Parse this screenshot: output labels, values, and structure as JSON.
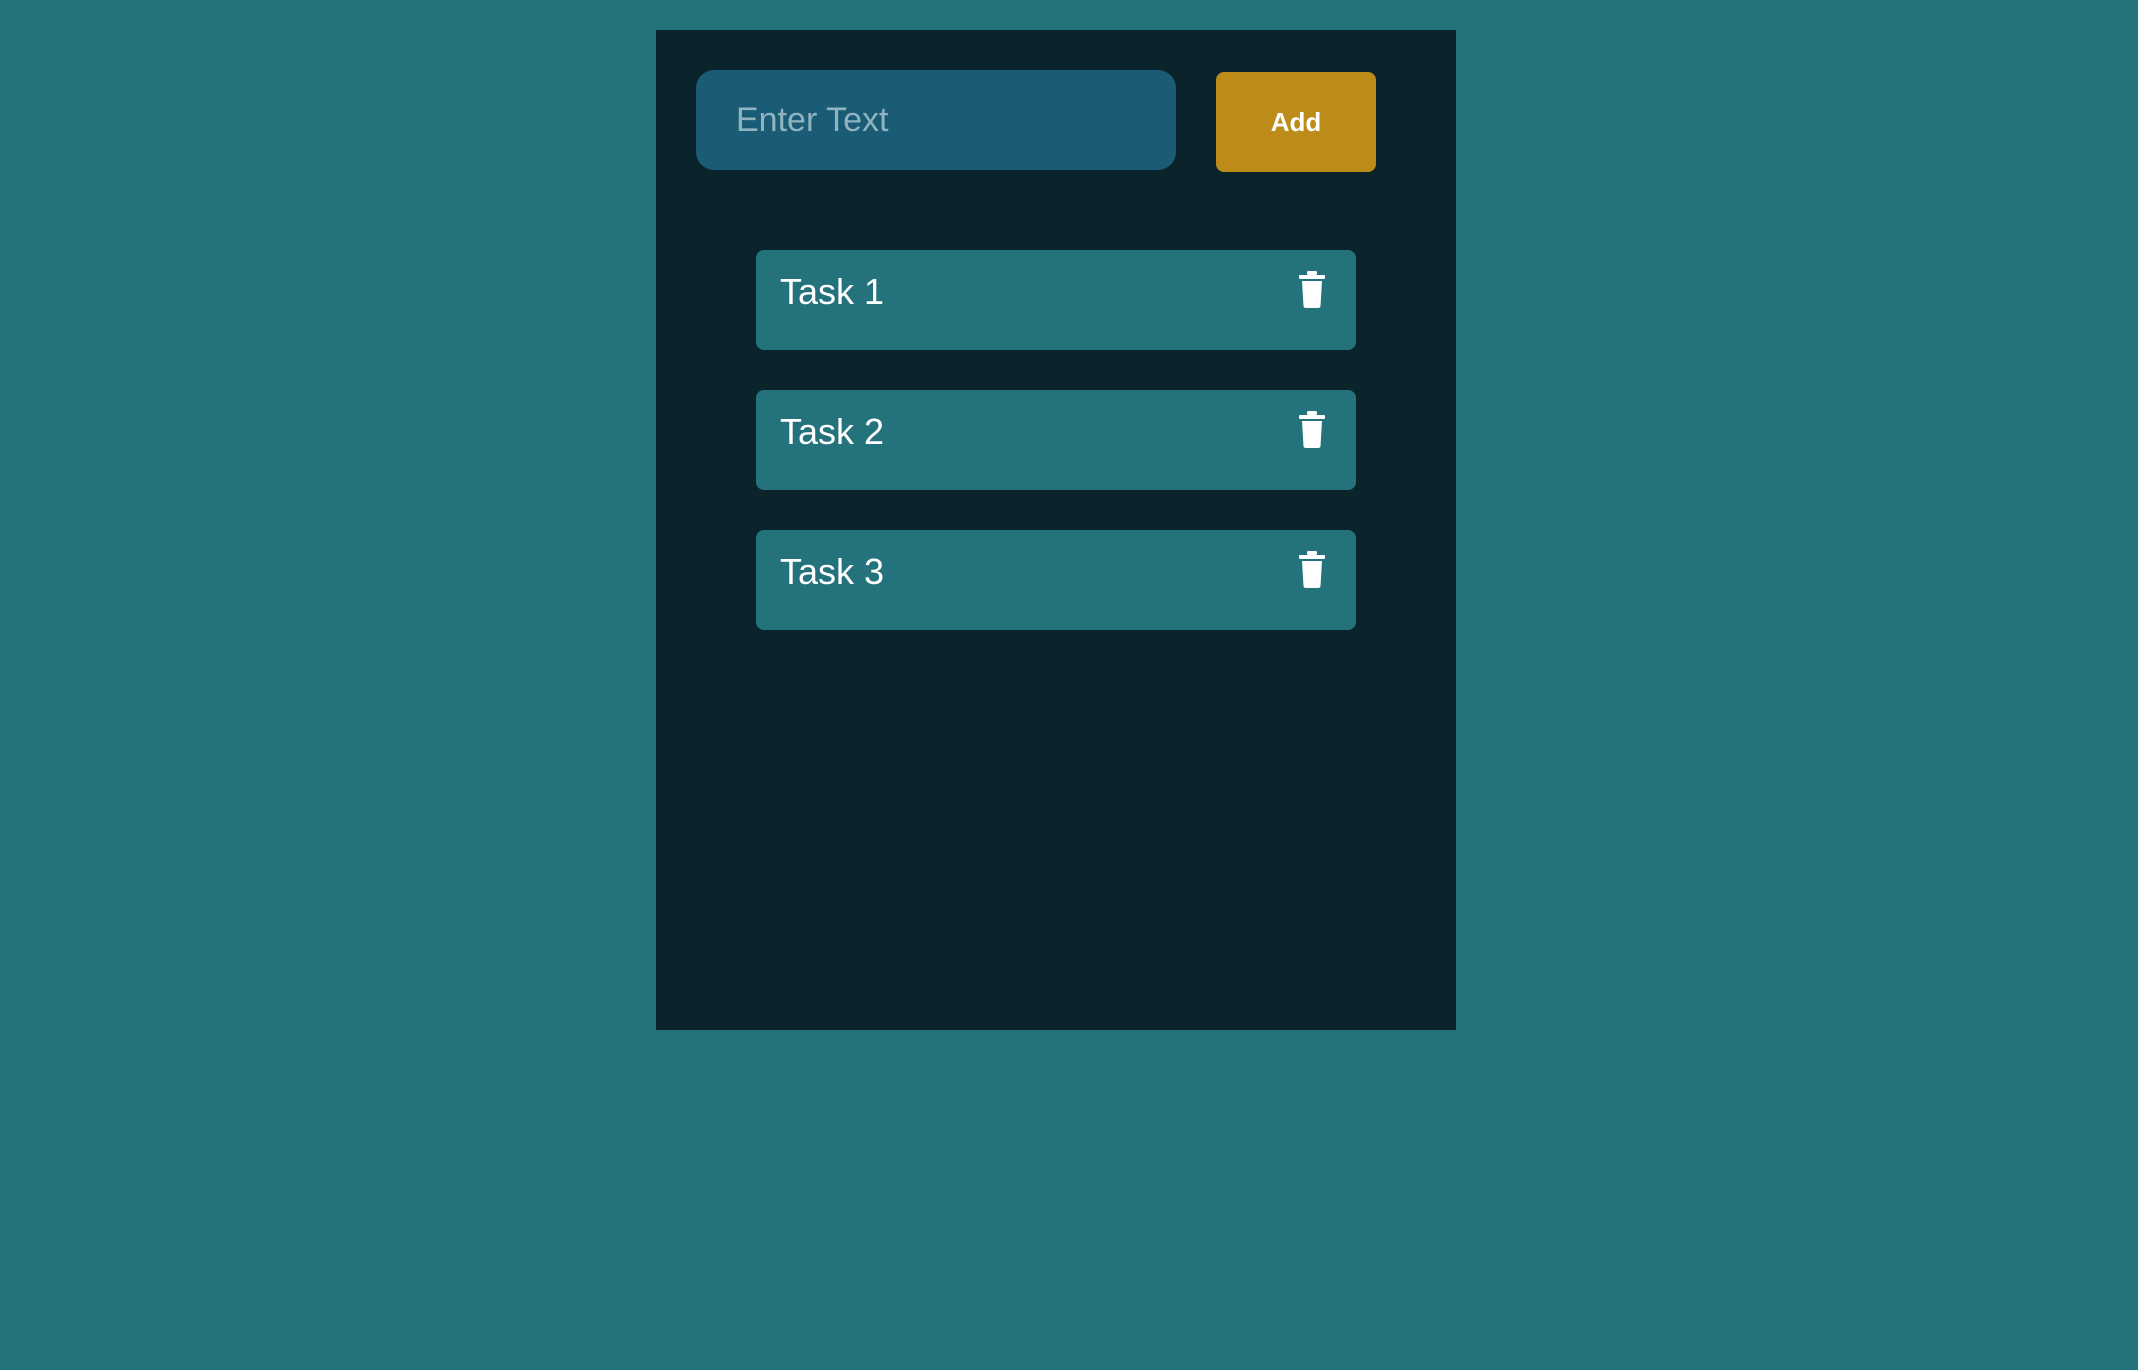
{
  "input": {
    "placeholder": "Enter Text",
    "value": ""
  },
  "add_button": {
    "label": "Add"
  },
  "tasks": [
    {
      "label": "Task 1",
      "action_icon": "trash-icon"
    },
    {
      "label": "Task 2",
      "action_icon": "trash-icon"
    },
    {
      "label": "Task 3",
      "action_icon": "trash-icon"
    }
  ],
  "colors": {
    "page_background": "#23727c",
    "panel_background": "#0b232a",
    "input_background": "#1a5c75",
    "add_button_background": "#bd8b18",
    "task_background": "#23727c",
    "text": "#ffffff"
  }
}
